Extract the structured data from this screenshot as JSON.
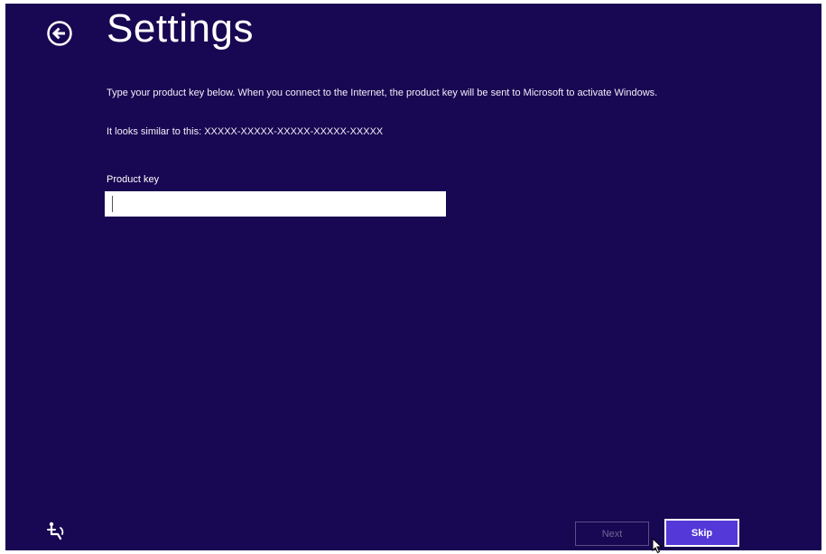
{
  "window": {
    "background_color": "#180752",
    "title": "Settings"
  },
  "header": {
    "back_icon": "back-arrow-circle-icon",
    "title": "Settings"
  },
  "content": {
    "instructions": "Type your product key below. When you connect to the Internet, the product key will be sent to Microsoft to activate Windows.",
    "example": "It looks similar to this: XXXXX-XXXXX-XXXXX-XXXXX-XXXXX",
    "product_key": {
      "label": "Product key",
      "value": "",
      "placeholder": ""
    }
  },
  "footer": {
    "ease_of_access_icon": "ease-of-access-icon",
    "next_label": "Next",
    "next_enabled": false,
    "skip_label": "Skip",
    "skip_color": "#5438d8"
  }
}
